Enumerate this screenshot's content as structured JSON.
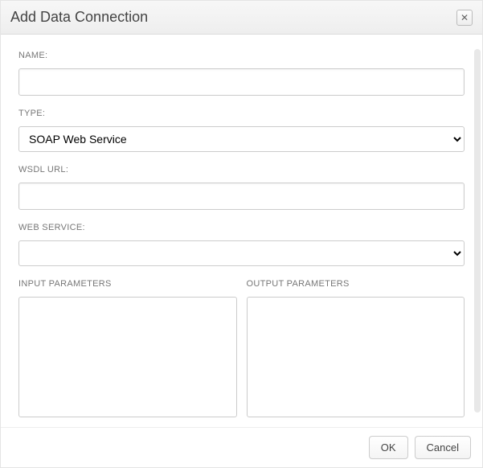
{
  "dialog": {
    "title": "Add Data Connection"
  },
  "fields": {
    "name_label": "NAME:",
    "name_value": "",
    "type_label": "TYPE:",
    "type_value": "SOAP Web Service",
    "wsdl_label": "WSDL URL:",
    "wsdl_value": "",
    "webservice_label": "WEB SERVICE:",
    "webservice_value": "",
    "input_params_label": "INPUT PARAMETERS",
    "output_params_label": "OUTPUT PARAMETERS"
  },
  "buttons": {
    "ok": "OK",
    "cancel": "Cancel"
  }
}
